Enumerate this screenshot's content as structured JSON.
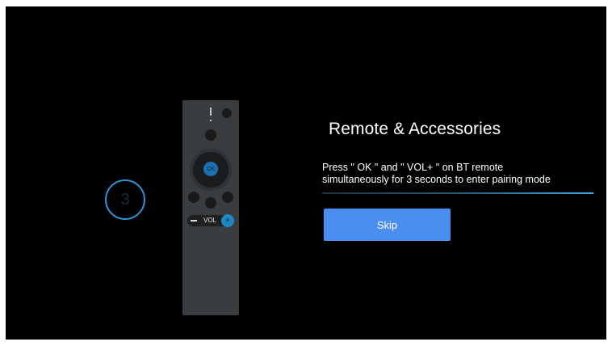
{
  "countdown": {
    "value": "3"
  },
  "remote": {
    "ok_label": "OK",
    "vol_minus": "−",
    "vol_label": "VOL",
    "vol_plus": "+"
  },
  "setup": {
    "title": "Remote & Accessories",
    "instruction_line1": "Press \" OK \" and \" VOL+ \" on BT remote",
    "instruction_line2": "simultaneously for 3 seconds to enter pairing mode",
    "skip_label": "Skip"
  },
  "colors": {
    "background": "#000000",
    "accent": "#2f93d6",
    "button": "#4a8ff0"
  }
}
